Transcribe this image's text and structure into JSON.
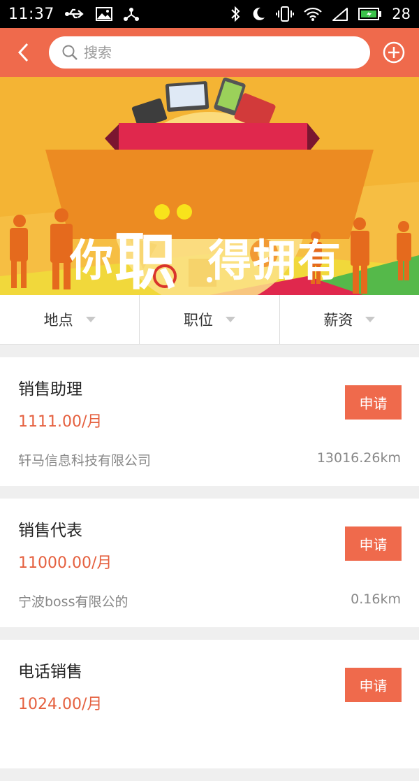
{
  "status_bar": {
    "time": "11:37",
    "battery_level": "28",
    "icons_left": [
      "usb-icon",
      "image-icon",
      "network-share-icon"
    ],
    "icons_right": [
      "bluetooth-icon",
      "moon-icon",
      "vibrate-icon",
      "wifi-icon",
      "no-sim-icon",
      "battery-icon"
    ]
  },
  "header": {
    "search_placeholder": "搜索",
    "accent_color": "#ef6a4c"
  },
  "banner": {
    "text_part1": "你",
    "text_part2": "职",
    "text_part3": "得拥有",
    "background_color": "#f4b434"
  },
  "filters": [
    {
      "label": "地点"
    },
    {
      "label": "职位"
    },
    {
      "label": "薪资"
    }
  ],
  "jobs": [
    {
      "title": "销售助理",
      "salary": "1111.00/月",
      "company": "轩马信息科技有限公司",
      "distance": "13016.26km",
      "apply_label": "申请"
    },
    {
      "title": "销售代表",
      "salary": "11000.00/月",
      "company": "宁波boss有限公的",
      "distance": "0.16km",
      "apply_label": "申请"
    },
    {
      "title": "电话销售",
      "salary": "1024.00/月",
      "company": "",
      "distance": "",
      "apply_label": "申请"
    }
  ]
}
